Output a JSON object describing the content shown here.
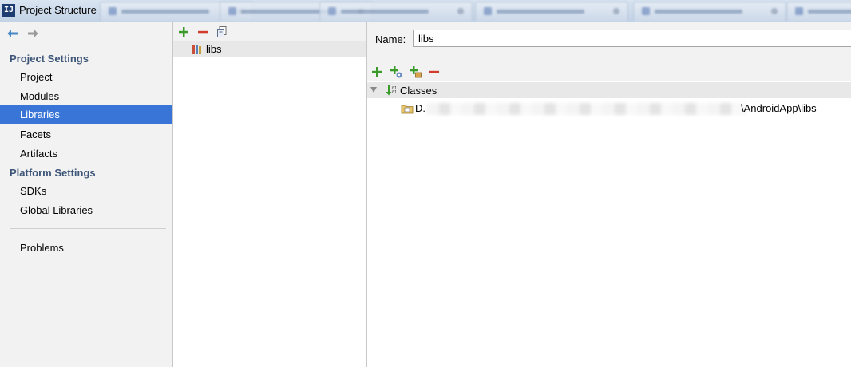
{
  "window": {
    "title": "Project Structure",
    "app_icon_text": "IJ"
  },
  "nav": {
    "sections": [
      {
        "label": "Project Settings",
        "items": [
          "Project",
          "Modules",
          "Libraries",
          "Facets",
          "Artifacts"
        ]
      },
      {
        "label": "Platform Settings",
        "items": [
          "SDKs",
          "Global Libraries"
        ]
      }
    ],
    "selected": "Libraries",
    "extra_items": [
      "Problems"
    ]
  },
  "libraries": {
    "items": [
      "libs"
    ]
  },
  "detail": {
    "name_label": "Name:",
    "name_value": "libs",
    "tree": {
      "root_label": "Classes",
      "path_start": "D.",
      "path_end": "\\AndroidApp\\libs"
    }
  },
  "colors": {
    "selection": "#3875d7",
    "add_green": "#3a9a2a",
    "remove_red": "#d23c2c",
    "section_header": "#3c5578"
  },
  "icons": {
    "back": "arrow-left-icon",
    "forward": "arrow-right-icon",
    "add": "plus-icon",
    "remove": "minus-icon",
    "copy": "copy-icon",
    "library": "library-icon",
    "classes": "classes-icon",
    "jar": "jar-folder-icon"
  }
}
